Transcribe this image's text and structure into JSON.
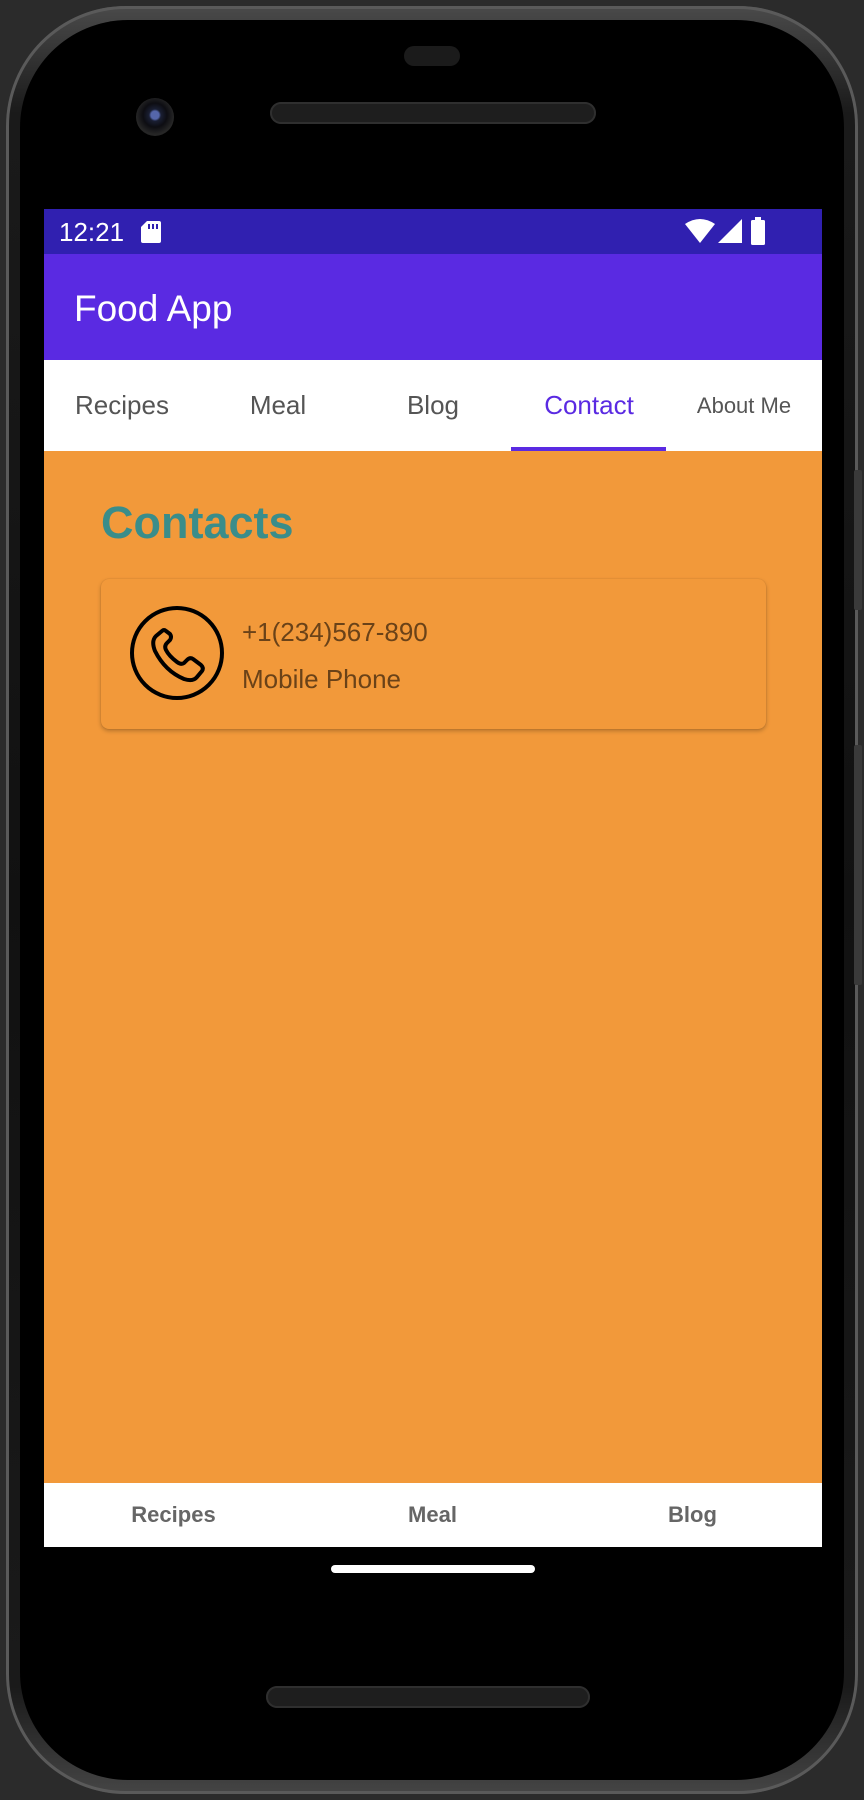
{
  "status_bar": {
    "time": "12:21",
    "icons": [
      "sd-card-icon",
      "wifi-icon",
      "cellular-signal-icon",
      "battery-icon"
    ]
  },
  "app_bar": {
    "title": "Food App"
  },
  "tabs": [
    {
      "label": "Recipes",
      "active": false
    },
    {
      "label": "Meal",
      "active": false
    },
    {
      "label": "Blog",
      "active": false
    },
    {
      "label": "Contact",
      "active": true
    },
    {
      "label": "About Me",
      "active": false
    }
  ],
  "content": {
    "title": "Contacts",
    "contacts": [
      {
        "icon": "phone-icon",
        "number": "+1(234)567-890",
        "type": "Mobile Phone"
      }
    ]
  },
  "bottom_nav": [
    {
      "label": "Recipes"
    },
    {
      "label": "Meal"
    },
    {
      "label": "Blog"
    }
  ],
  "colors": {
    "status_bar": "#3020b0",
    "app_bar": "#5a2ae2",
    "accent": "#5a2ae2",
    "background": "#f2993a",
    "title": "#3a8d8a",
    "contact_text": "#6a4218"
  }
}
